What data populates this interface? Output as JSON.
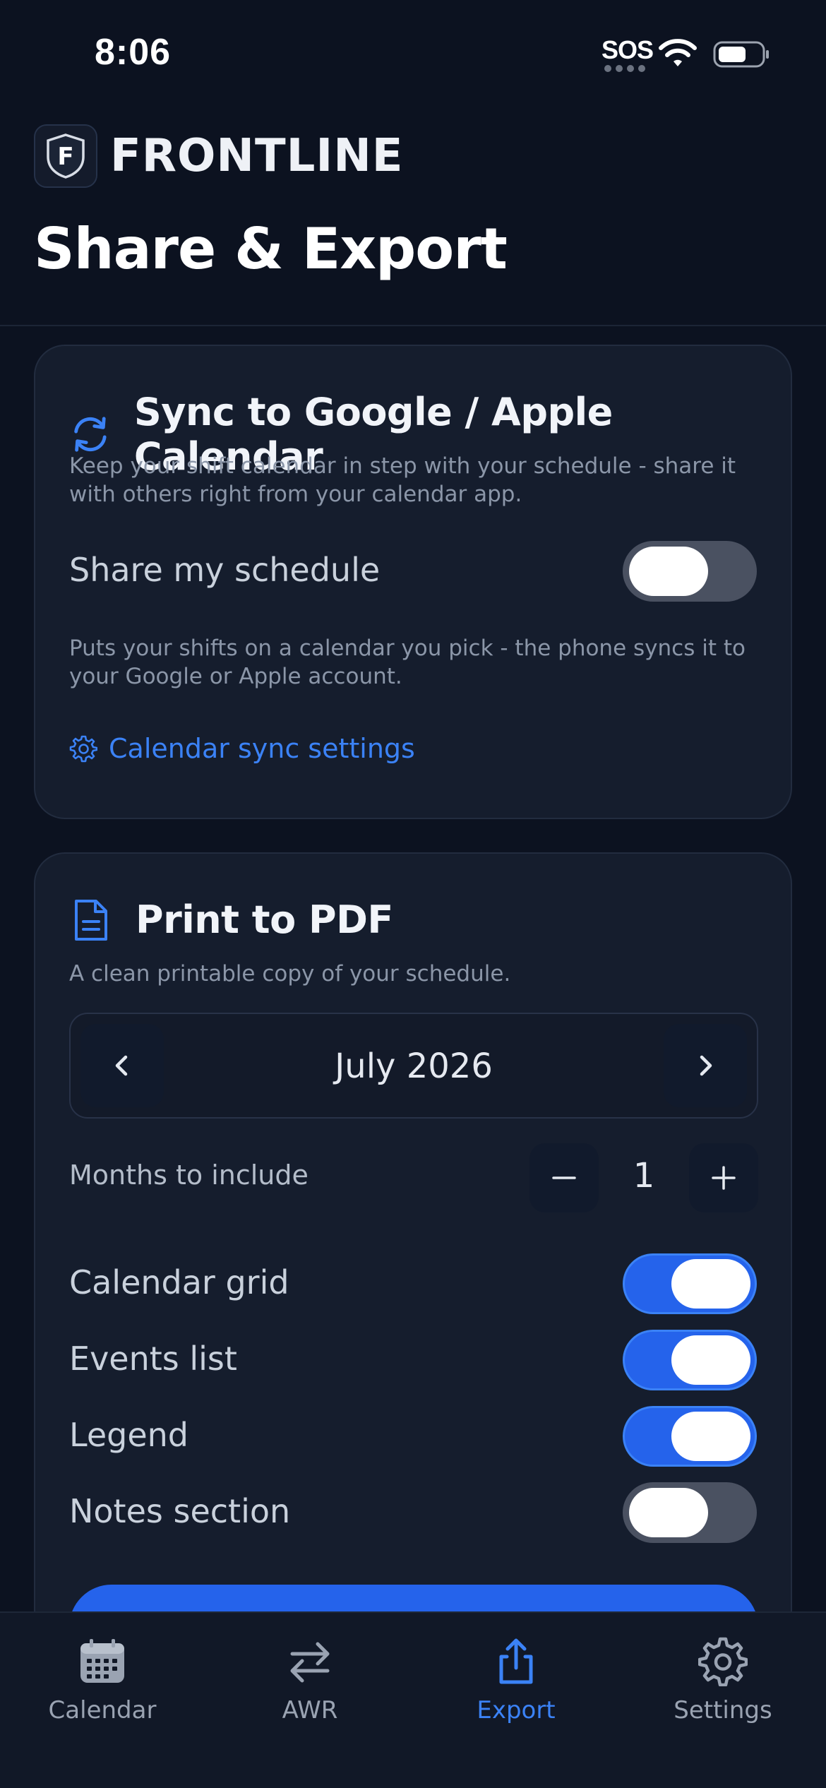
{
  "status_bar": {
    "time": "8:06",
    "sos": "SOS",
    "icons": [
      "wifi-icon",
      "battery-icon"
    ]
  },
  "brand": {
    "logo_letter": "F",
    "name": "FRONTLINE"
  },
  "page_title": "Share & Export",
  "sync_card": {
    "icon": "sync-icon",
    "title": "Sync to Google / Apple Calendar",
    "description": "Keep your shift calendar in step with your schedule - share it with others right from your calendar app.",
    "share_label": "Share my schedule",
    "share_enabled": false,
    "share_hint": "Puts your shifts on a calendar you pick - the phone syncs it to your Google or Apple account.",
    "settings_link": "Calendar sync settings",
    "settings_icon": "gear-icon"
  },
  "pdf_card": {
    "icon": "document-icon",
    "title": "Print to PDF",
    "description": "A clean printable copy of your schedule.",
    "month": "July 2026",
    "months_label": "Months to include",
    "months_value": "1",
    "options": [
      {
        "label": "Calendar grid",
        "enabled": true
      },
      {
        "label": "Events list",
        "enabled": true
      },
      {
        "label": "Legend",
        "enabled": true
      },
      {
        "label": "Notes section",
        "enabled": false
      }
    ]
  },
  "colors": {
    "accent": "#2563eb",
    "link": "#3b82f6",
    "background": "#0c1220",
    "card": "#151d2d"
  },
  "tab_bar": {
    "tabs": [
      {
        "label": "Calendar",
        "icon": "calendar-icon",
        "active": false
      },
      {
        "label": "AWR",
        "icon": "swap-arrows-icon",
        "active": false
      },
      {
        "label": "Export",
        "icon": "share-icon",
        "active": true
      },
      {
        "label": "Settings",
        "icon": "gear-icon",
        "active": false
      }
    ]
  }
}
